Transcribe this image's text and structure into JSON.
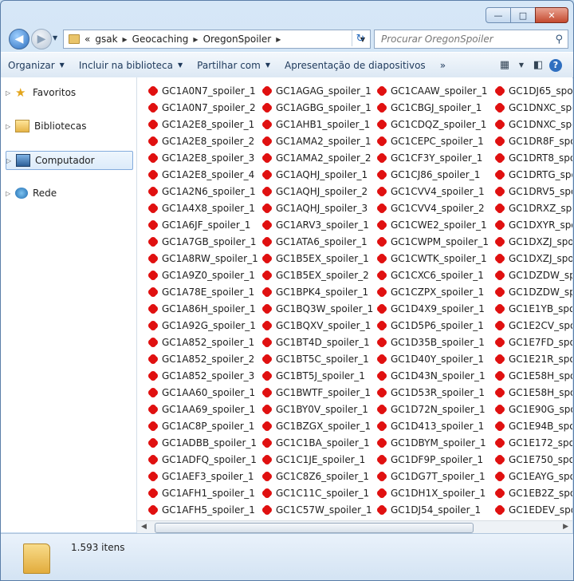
{
  "window": {
    "caption_buttons": {
      "minimize": "—",
      "maximize": "□",
      "close": "✕"
    }
  },
  "nav": {
    "back_icon": "back-arrow-icon",
    "forward_icon": "forward-arrow-icon",
    "breadcrumb": {
      "overflow": "«",
      "items": [
        "gsak",
        "Geocaching",
        "OregonSpoiler"
      ]
    },
    "search_placeholder": "Procurar OregonSpoiler"
  },
  "toolbar": {
    "organize": "Organizar",
    "include_library": "Incluir na biblioteca",
    "share": "Partilhar com",
    "slideshow": "Apresentação de diapositivos",
    "more": "»"
  },
  "sidebar": {
    "items": [
      {
        "label": "Favoritos",
        "icon": "star-icon"
      },
      {
        "label": "Bibliotecas",
        "icon": "library-icon"
      },
      {
        "label": "Computador",
        "icon": "computer-icon",
        "selected": true
      },
      {
        "label": "Rede",
        "icon": "network-icon"
      }
    ]
  },
  "files": {
    "col1": [
      "GC1A0N7_spoiler_1",
      "GC1A0N7_spoiler_2",
      "GC1A2E8_spoiler_1",
      "GC1A2E8_spoiler_2",
      "GC1A2E8_spoiler_3",
      "GC1A2E8_spoiler_4",
      "GC1A2N6_spoiler_1",
      "GC1A4X8_spoiler_1",
      "GC1A6JF_spoiler_1",
      "GC1A7GB_spoiler_1",
      "GC1A8RW_spoiler_1",
      "GC1A9Z0_spoiler_1",
      "GC1A78E_spoiler_1",
      "GC1A86H_spoiler_1",
      "GC1A92G_spoiler_1",
      "GC1A852_spoiler_1",
      "GC1A852_spoiler_2",
      "GC1A852_spoiler_3",
      "GC1AA60_spoiler_1",
      "GC1AA69_spoiler_1",
      "GC1AC8P_spoiler_1",
      "GC1ADBB_spoiler_1",
      "GC1ADFQ_spoiler_1",
      "GC1AEF3_spoiler_1",
      "GC1AFH1_spoiler_1",
      "GC1AFH5_spoiler_1"
    ],
    "col2": [
      "GC1AGAG_spoiler_1",
      "GC1AGBG_spoiler_1",
      "GC1AHB1_spoiler_1",
      "GC1AMA2_spoiler_1",
      "GC1AMA2_spoiler_2",
      "GC1AQHJ_spoiler_1",
      "GC1AQHJ_spoiler_2",
      "GC1AQHJ_spoiler_3",
      "GC1ARV3_spoiler_1",
      "GC1ATA6_spoiler_1",
      "GC1B5EX_spoiler_1",
      "GC1B5EX_spoiler_2",
      "GC1BPK4_spoiler_1",
      "GC1BQ3W_spoiler_1",
      "GC1BQXV_spoiler_1",
      "GC1BT4D_spoiler_1",
      "GC1BT5C_spoiler_1",
      "GC1BT5J_spoiler_1",
      "GC1BWTF_spoiler_1",
      "GC1BY0V_spoiler_1",
      "GC1BZGX_spoiler_1",
      "GC1C1BA_spoiler_1",
      "GC1C1JE_spoiler_1",
      "GC1C8Z6_spoiler_1",
      "GC1C11C_spoiler_1",
      "GC1C57W_spoiler_1"
    ],
    "col3": [
      "GC1CAAW_spoiler_1",
      "GC1CBGJ_spoiler_1",
      "GC1CDQZ_spoiler_1",
      "GC1CEPC_spoiler_1",
      "GC1CF3Y_spoiler_1",
      "GC1CJ86_spoiler_1",
      "GC1CVV4_spoiler_1",
      "GC1CVV4_spoiler_2",
      "GC1CWE2_spoiler_1",
      "GC1CWPM_spoiler_1",
      "GC1CWTK_spoiler_1",
      "GC1CXC6_spoiler_1",
      "GC1CZPX_spoiler_1",
      "GC1D4X9_spoiler_1",
      "GC1D5P6_spoiler_1",
      "GC1D35B_spoiler_1",
      "GC1D40Y_spoiler_1",
      "GC1D43N_spoiler_1",
      "GC1D53R_spoiler_1",
      "GC1D72N_spoiler_1",
      "GC1D413_spoiler_1",
      "GC1DBYM_spoiler_1",
      "GC1DF9P_spoiler_1",
      "GC1DG7T_spoiler_1",
      "GC1DH1X_spoiler_1",
      "GC1DJ54_spoiler_1"
    ],
    "col4": [
      "GC1DJ65_spo",
      "GC1DNXC_spo",
      "GC1DNXC_spo",
      "GC1DR8F_spo",
      "GC1DRT8_spo",
      "GC1DRTG_spo",
      "GC1DRV5_spo",
      "GC1DRXZ_spo",
      "GC1DXYR_spo",
      "GC1DXZJ_spo",
      "GC1DXZJ_spo",
      "GC1DZDW_spo",
      "GC1DZDW_spo",
      "GC1E1YB_spo",
      "GC1E2CV_spo",
      "GC1E7FD_spo",
      "GC1E21R_spo",
      "GC1E58H_spo",
      "GC1E58H_spo",
      "GC1E90G_spo",
      "GC1E94B_spo",
      "GC1E172_spo",
      "GC1E750_spo",
      "GC1EAYG_spo",
      "GC1EB2Z_spo",
      "GC1EDEV_spo"
    ]
  },
  "status": {
    "count": "1.593 itens"
  }
}
